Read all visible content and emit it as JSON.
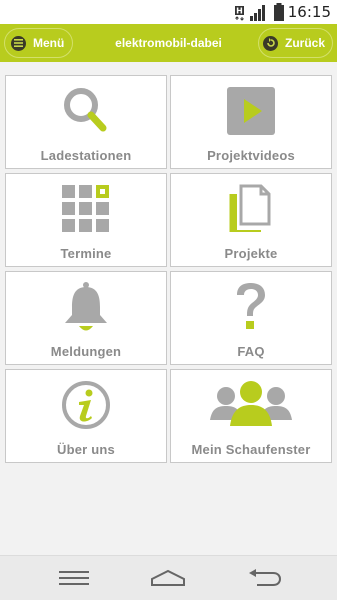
{
  "status_bar": {
    "time": "16:15"
  },
  "app_bar": {
    "menu_label": "Menü",
    "title": "elektromobil-dabei",
    "back_label": "Zurück"
  },
  "tiles": [
    {
      "label": "Ladestationen",
      "icon": "search-icon"
    },
    {
      "label": "Projektvideos",
      "icon": "play-icon"
    },
    {
      "label": "Termine",
      "icon": "calendar-grid-icon"
    },
    {
      "label": "Projekte",
      "icon": "documents-icon"
    },
    {
      "label": "Meldungen",
      "icon": "bell-icon"
    },
    {
      "label": "FAQ",
      "icon": "question-mark-icon"
    },
    {
      "label": "Über uns",
      "icon": "info-icon"
    },
    {
      "label": "Mein Schaufenster",
      "icon": "people-group-icon"
    }
  ],
  "colors": {
    "accent": "#b8cc1e",
    "icon_gray": "#a8a8a8",
    "label_gray": "#8a8a8a"
  }
}
